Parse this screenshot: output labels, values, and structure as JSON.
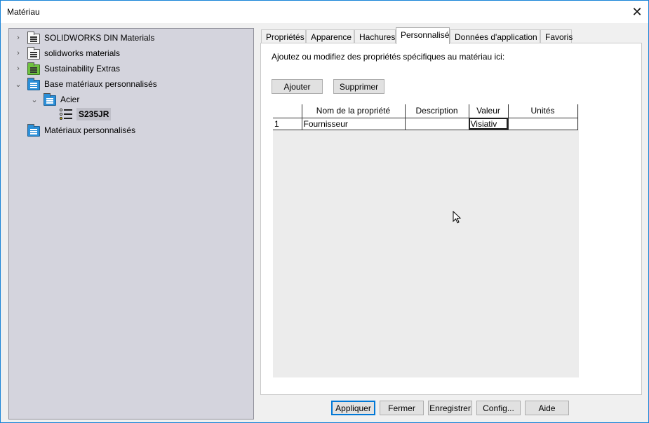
{
  "window": {
    "title": "Matériau",
    "close_glyph": "✕"
  },
  "tree": {
    "nodes": [
      {
        "label": "SOLIDWORKS DIN Materials",
        "chevron": "›",
        "icon": "library-folder-icon"
      },
      {
        "label": "solidworks materials",
        "chevron": "›",
        "icon": "library-folder-icon"
      },
      {
        "label": "Sustainability Extras",
        "chevron": "›",
        "icon": "green-library-folder-icon"
      },
      {
        "label": "Base matériaux personnalisés",
        "chevron": "⌄",
        "icon": "blue-library-folder-icon"
      },
      {
        "label": "Acier",
        "chevron": "⌄",
        "icon": "blue-category-folder-icon"
      },
      {
        "label": "S235JR",
        "chevron": "",
        "icon": "material-icon"
      },
      {
        "label": "Matériaux personnalisés",
        "chevron": "",
        "icon": "blue-library-folder-icon"
      }
    ]
  },
  "tabs": [
    "Propriétés",
    "Apparence",
    "Hachures",
    "Personnalisé",
    "Données d'application",
    "Favoris"
  ],
  "active_tab": "Personnalisé",
  "custom": {
    "hint": "Ajoutez ou modifiez des propriétés spécifiques au matériau ici:",
    "add_label": "Ajouter",
    "delete_label": "Supprimer",
    "columns": [
      "Nom de la propriété",
      "Description",
      "Valeur",
      "Unités"
    ],
    "rows": [
      {
        "index": "1",
        "name": "Fournisseur",
        "description": "",
        "value": "Visiativ",
        "units": ""
      }
    ]
  },
  "footer": {
    "apply": "Appliquer",
    "close": "Fermer",
    "save": "Enregistrer",
    "config": "Config...",
    "help": "Aide"
  }
}
